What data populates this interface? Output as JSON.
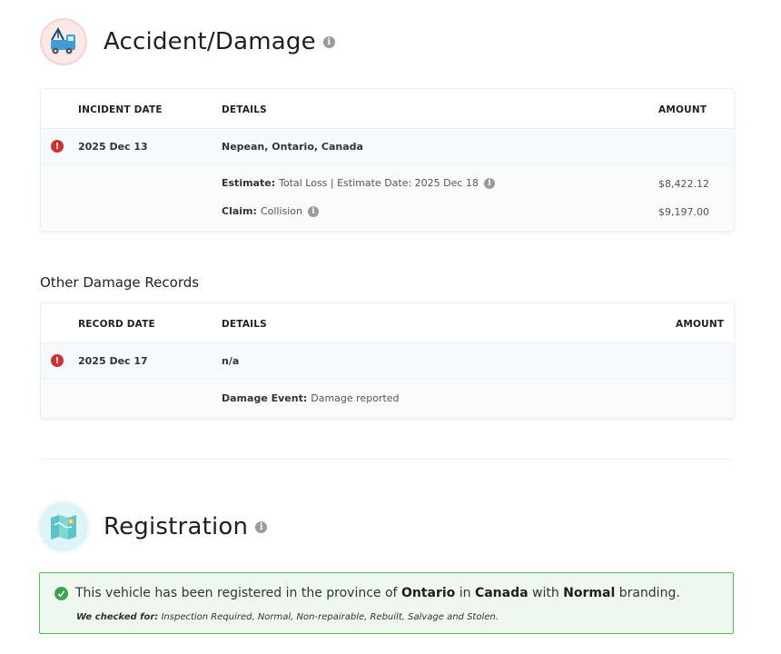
{
  "accident": {
    "title": "Accident/Damage",
    "columns": {
      "date": "INCIDENT DATE",
      "details": "DETAILS",
      "amount": "AMOUNT"
    },
    "incident": {
      "date": "2025 Dec 13",
      "location": "Nepean, Ontario, Canada",
      "estimate_label": "Estimate:",
      "estimate_value": "Total Loss | Estimate Date: 2025 Dec 18",
      "estimate_amount": "$8,422.12",
      "claim_label": "Claim:",
      "claim_value": "Collision",
      "claim_amount": "$9,197.00"
    }
  },
  "other_damage": {
    "title": "Other Damage Records",
    "columns": {
      "date": "RECORD DATE",
      "details": "DETAILS",
      "amount": "AMOUNT"
    },
    "record": {
      "date": "2025 Dec 17",
      "details": "n/a",
      "event_label": "Damage Event:",
      "event_value": "Damage reported"
    }
  },
  "registration": {
    "title": "Registration",
    "msg_prefix": "This vehicle has been registered in the province of",
    "province": "Ontario",
    "msg_in": "in",
    "country": "Canada",
    "msg_with": "with",
    "branding": "Normal",
    "msg_suffix": "branding.",
    "checked_label": "We checked for:",
    "checked_items": "Inspection Required, Normal, Non-repairable, Rebuilt, Salvage and Stolen."
  },
  "icons": {
    "info": "info-icon",
    "alert": "alert-icon",
    "check": "check-circle-icon",
    "tow": "tow-truck-icon",
    "map": "map-icon"
  },
  "colors": {
    "alert": "#d32f2f",
    "success": "#3fa34d",
    "success_bg": "#eef8ee",
    "icon_grey": "#9a9a9a"
  }
}
